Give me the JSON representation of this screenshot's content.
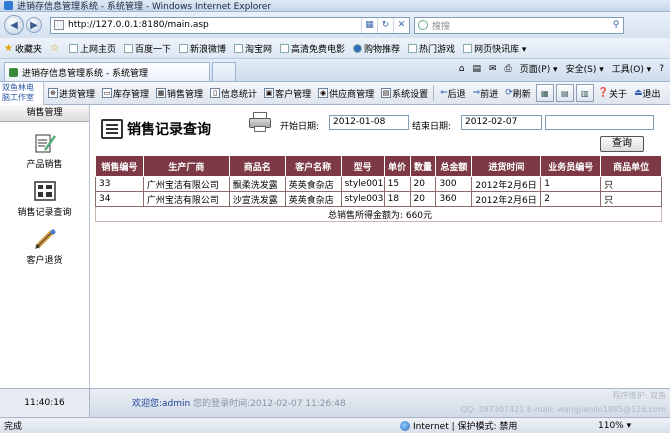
{
  "window": {
    "title": "进销存信息管理系统 - 系统管理 - Windows Internet Explorer"
  },
  "browser": {
    "url": "http://127.0.0.1:8180/main.asp",
    "search_placeholder": "搜搜",
    "favorites_label": "收藏夹",
    "favorites": [
      "上网主页",
      "百度一下",
      "新浪微博",
      "淘宝网",
      "高清免费电影",
      "购物推荐",
      "热门游戏",
      "网页快讯库 ▾"
    ],
    "tab_title": "进销存信息管理系统 - 系统管理",
    "tools": [
      "页面(P) ▾",
      "安全(S) ▾",
      "工具(O) ▾",
      "?"
    ]
  },
  "app": {
    "logo_text": "双鱼林电脑工作室",
    "toolbar": [
      {
        "id": "purchase",
        "label": "进货管理"
      },
      {
        "id": "stock",
        "label": "库存管理"
      },
      {
        "id": "sales",
        "label": "销售管理"
      },
      {
        "id": "stats",
        "label": "信息统计"
      },
      {
        "id": "customer",
        "label": "客户管理"
      },
      {
        "id": "supplier",
        "label": "供应商管理"
      },
      {
        "id": "settings",
        "label": "系统设置"
      },
      {
        "id": "back",
        "label": "后退"
      },
      {
        "id": "forward",
        "label": "前进"
      },
      {
        "id": "refresh",
        "label": "刷新"
      },
      {
        "id": "about",
        "label": "关于"
      },
      {
        "id": "exit",
        "label": "退出"
      }
    ],
    "sidebar": {
      "title": "销售管理",
      "items": [
        {
          "label": "产品销售"
        },
        {
          "label": "销售记录查询"
        },
        {
          "label": "客户退货"
        }
      ]
    },
    "query": {
      "title": "销售记录查询",
      "start_label": "开始日期:",
      "start_value": "2012-01-08",
      "end_label": "结束日期:",
      "end_value": "2012-02-07",
      "extra_value": "",
      "button": "查询"
    },
    "table": {
      "headers": [
        "销售编号",
        "生产厂商",
        "商品名",
        "客户名称",
        "型号",
        "单价",
        "数量",
        "总金额",
        "进货时间",
        "业务员编号",
        "商品单位"
      ],
      "rows": [
        [
          "33",
          "广州宝洁有限公司",
          "飘柔洗发露",
          "英英食杂店",
          "style001",
          "15",
          "20",
          "300",
          "2012年2月6日",
          "1",
          "只"
        ],
        [
          "34",
          "广州宝洁有限公司",
          "沙宣洗发露",
          "英英食杂店",
          "style003",
          "18",
          "20",
          "360",
          "2012年2月6日",
          "2",
          "只"
        ]
      ],
      "total": "总销售所得金额为: 660元"
    },
    "footer": {
      "clock": "11:40:16",
      "welcome_prefix": "欢迎您:",
      "user": "admin",
      "login_info": " 您的登录时间:2012-02-07 11:26:48",
      "maint_line1": "程序维护: 双鱼",
      "maint_line2": "QQ: 287307421 E-mail: wangjianlin1985@126.com"
    }
  },
  "status": {
    "done": "完成",
    "zone": "Internet | 保护模式: 禁用",
    "zoom": "110% ▾"
  }
}
